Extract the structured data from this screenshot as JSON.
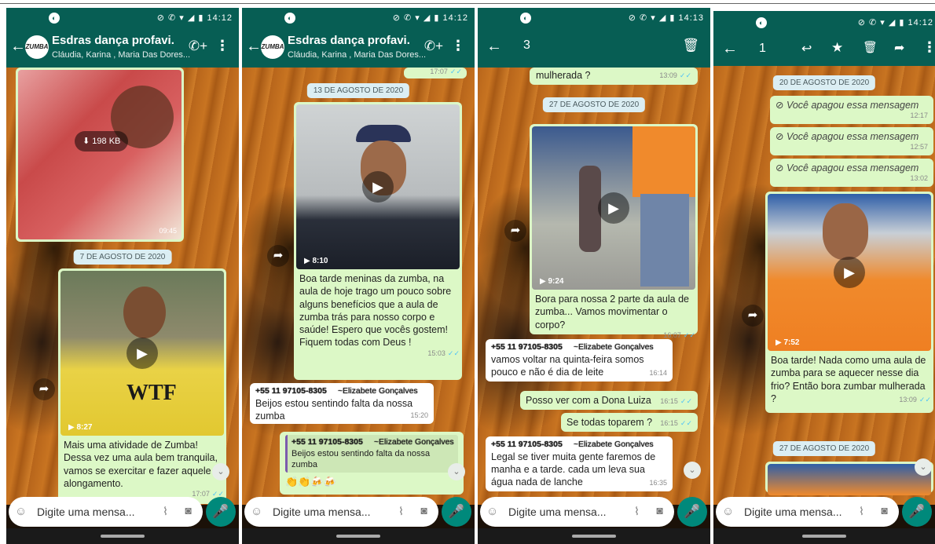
{
  "status": {
    "time1": "14:12",
    "time2": "14:12",
    "time3": "14:13",
    "time4": "14:12",
    "icons": "⊘ ✆ ▾ ◢ ▮"
  },
  "chat": {
    "title": "Esdras  dança profavi.",
    "subtitle": "Cláudia, Karina , Maria Das Dores...",
    "avatar_text": "ZUMBA",
    "input_placeholder": "Digite uma mensa..."
  },
  "selection": {
    "count3": "3",
    "count4": "1"
  },
  "p1": {
    "file_size": "198 KB",
    "img_time": "09:45",
    "date": "7 DE AGOSTO DE 2020",
    "video_dur": "8:27",
    "caption": "Mais uma atividade de Zumba! Dessa vez uma aula bem tranquila, vamos se exercitar e fazer aquele alongamento.",
    "caption_time": "17:07"
  },
  "p2": {
    "top_time": "17:07",
    "date": "13 DE AGOSTO DE 2020",
    "video_dur": "8:10",
    "caption": "Boa tarde meninas da zumba, na aula de hoje trago um pouco sobre alguns benefícios que a aula de zumba trás para nosso corpo e saúde! Espero que vocês gostem! Fiquem todas com Deus !",
    "caption_time": "15:03",
    "sender_phone": "+55 11 97105-8305",
    "sender_alias": "~Elizabete Gonçalves",
    "msg": "Beijos estou sentindo falta da nossa zumba",
    "msg_time": "15:20",
    "reply_phone": "+55 11 97105-8305",
    "reply_alias": "~Elizabete Gonçalves",
    "reply_quote": "Beijos estou sentindo falta da nossa zumba"
  },
  "p3": {
    "top_text": "mulherada ?",
    "top_time": "13:09",
    "date": "27 DE AGOSTO DE 2020",
    "video_dur": "9:24",
    "caption": "Bora para nossa 2 parte da aula de zumba... Vamos movimentar o corpo?",
    "caption_time": "16:07",
    "sender_phone": "+55 11 97105-8305",
    "sender_alias": "~Elizabete Gonçalves",
    "msg1": "vamos voltar na quinta-feira somos pouco e não é dia de leite",
    "msg1_time": "16:14",
    "msg2": "Posso ver com a Dona Luiza",
    "msg2_time": "16:15",
    "msg3": "Se todas toparem ?",
    "msg3_time": "16:15",
    "sender2_phone": "+55 11 97105-8305",
    "sender2_alias": "~Elizabete Gonçalves",
    "msg4": "Legal se tiver muita gente faremos de manha e a tarde. cada um leva sua água nada de lanche",
    "msg4_time": "16:35"
  },
  "p4": {
    "date": "20 DE AGOSTO DE 2020",
    "deleted_text": "Você apagou essa mensagem",
    "del_time1": "12:17",
    "del_time2": "12:57",
    "del_time3": "13:02",
    "video_dur": "7:52",
    "caption": "Boa tarde! Nada como uma aula de zumba para se aquecer nesse dia frio? Então bora zumbar mulherada ?",
    "caption_time": "13:09",
    "date2": "27 DE AGOSTO DE 2020"
  }
}
